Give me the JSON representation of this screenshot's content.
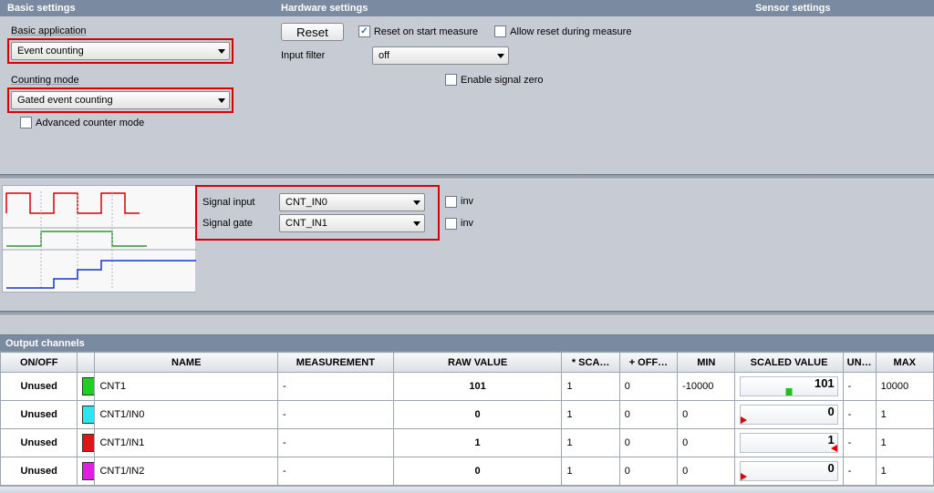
{
  "headers": {
    "basic": "Basic settings",
    "hardware": "Hardware settings",
    "sensor": "Sensor settings",
    "output": "Output channels"
  },
  "basic": {
    "application_label": "Basic application",
    "application_value": "Event counting",
    "mode_label": "Counting mode",
    "mode_value": "Gated event counting",
    "advanced_label": "Advanced counter mode",
    "advanced_checked": false
  },
  "hardware": {
    "reset_button": "Reset",
    "reset_on_start_label": "Reset on start measure",
    "reset_on_start_checked": true,
    "allow_reset_label": "Allow reset during measure",
    "allow_reset_checked": false,
    "input_filter_label": "Input filter",
    "input_filter_value": "off",
    "enable_signal_zero_label": "Enable signal zero",
    "enable_signal_zero_checked": false
  },
  "signal": {
    "input_label": "Signal input",
    "input_value": "CNT_IN0",
    "input_inv_label": "inv",
    "input_inv_checked": false,
    "gate_label": "Signal gate",
    "gate_value": "CNT_IN1",
    "gate_inv_label": "inv",
    "gate_inv_checked": false
  },
  "columns": {
    "onoff": "ON/OFF",
    "swatch": "",
    "name": "NAME",
    "measurement": "MEASUREMENT",
    "raw": "RAW VALUE",
    "sca": "* SCA…",
    "off": "+ OFF…",
    "min": "MIN",
    "scaled": "SCALED VALUE",
    "un": "UN…",
    "max": "MAX"
  },
  "rows": [
    {
      "onoff": "Unused",
      "color": "#1fd11f",
      "name": "CNT1",
      "measurement": "-",
      "raw": "101",
      "sca": "1",
      "off": "0",
      "min": "-10000",
      "scaled": "101",
      "marker": "green",
      "un": "-",
      "max": "10000"
    },
    {
      "onoff": "Unused",
      "color": "#27e7f4",
      "name": "CNT1/IN0",
      "measurement": "-",
      "raw": "0",
      "sca": "1",
      "off": "0",
      "min": "0",
      "scaled": "0",
      "marker": "left",
      "un": "-",
      "max": "1"
    },
    {
      "onoff": "Unused",
      "color": "#e01414",
      "name": "CNT1/IN1",
      "measurement": "-",
      "raw": "1",
      "sca": "1",
      "off": "0",
      "min": "0",
      "scaled": "1",
      "marker": "right",
      "un": "-",
      "max": "1"
    },
    {
      "onoff": "Unused",
      "color": "#e31de3",
      "name": "CNT1/IN2",
      "measurement": "-",
      "raw": "0",
      "sca": "1",
      "off": "0",
      "min": "0",
      "scaled": "0",
      "marker": "left",
      "un": "-",
      "max": "1"
    }
  ]
}
